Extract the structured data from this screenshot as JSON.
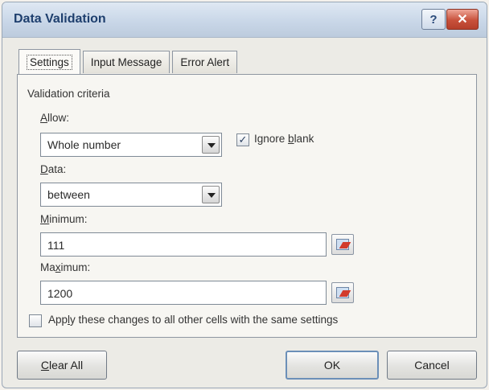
{
  "window": {
    "title": "Data Validation"
  },
  "titlebar": {
    "help_label": "?",
    "close_label": "✕"
  },
  "tabs": [
    {
      "label": "Settings",
      "active": true
    },
    {
      "label": "Input Message",
      "active": false
    },
    {
      "label": "Error Alert",
      "active": false
    }
  ],
  "criteria": {
    "heading": "Validation criteria",
    "allow": {
      "label_u": "A",
      "label_rest": "llow:",
      "value": "Whole number"
    },
    "ignore_blank": {
      "checked": true,
      "check_glyph": "✓",
      "label_pre": "I",
      "label_mid": "gnore ",
      "label_u": "b",
      "label_post": "lank"
    },
    "data": {
      "label_u": "D",
      "label_rest": "ata:",
      "value": "between"
    },
    "minimum": {
      "label_u": "M",
      "label_rest": "inimum:",
      "value": "111"
    },
    "maximum": {
      "label_pre": "Ma",
      "label_u": "x",
      "label_rest": "imum:",
      "value": "1200"
    }
  },
  "apply_all": {
    "checked": false,
    "label_pre": "App",
    "label_u": "l",
    "label_rest": "y these changes to all other cells with the same settings"
  },
  "buttons": {
    "clear_all": {
      "label_u": "C",
      "label_rest": "lear All"
    },
    "ok": "OK",
    "cancel": "Cancel"
  }
}
